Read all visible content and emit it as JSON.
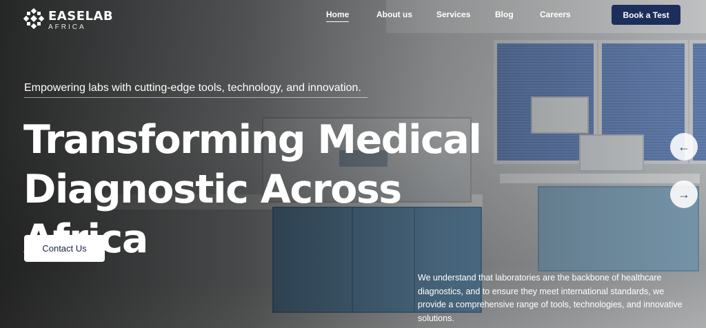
{
  "brand": {
    "name": "EASELAB",
    "subtitle": "AFRICA",
    "logo_icon": "grid-diamond-logo-icon"
  },
  "nav": {
    "items": [
      {
        "label": "Home",
        "active": true
      },
      {
        "label": "About us",
        "active": false
      },
      {
        "label": "Services",
        "active": false
      },
      {
        "label": "Blog",
        "active": false
      },
      {
        "label": "Careers",
        "active": false
      }
    ],
    "cta_label": "Book a Test"
  },
  "hero": {
    "tagline": "Empowering labs with cutting-edge tools, technology, and innovation.",
    "headline_line1": "Transforming Medical",
    "headline_line2": "Diagnostic Across Africa",
    "cta_label": "Contact Us",
    "description": "We understand that laboratories are the backbone of healthcare diagnostics, and to ensure they meet international standards, we provide a comprehensive range of tools, technologies, and innovative solutions."
  },
  "carousel": {
    "prev_glyph": "←",
    "next_glyph": "→",
    "prev_icon": "arrow-left-icon",
    "next_icon": "arrow-right-icon"
  },
  "colors": {
    "primary_button": "#1c2f5a",
    "button_light": "#ffffff",
    "text": "#ffffff"
  }
}
